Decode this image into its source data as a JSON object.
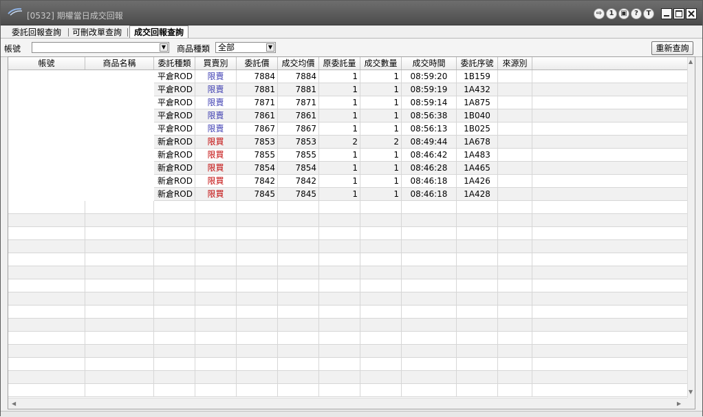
{
  "window": {
    "title": "[0532] 期權當日成交回報",
    "title_buttons": [
      "1",
      "?",
      "T"
    ]
  },
  "tabs": [
    {
      "label": "委託回報查詢",
      "active": false
    },
    {
      "label": "可刪改單查詢",
      "active": false
    },
    {
      "label": "成交回報查詢",
      "active": true
    }
  ],
  "filters": {
    "account_label": "帳號",
    "account_value": "",
    "product_type_label": "商品種類",
    "product_type_value": "全部",
    "requery_label": "重新查詢"
  },
  "colors": {
    "sell": "#3a3ab0",
    "buy": "#c00000",
    "titlebar": "#5a5a5a"
  },
  "table": {
    "headers": [
      "帳號",
      "商品名稱",
      "委託種類",
      "買賣別",
      "委託價",
      "成交均價",
      "原委託量",
      "成交數量",
      "成交時間",
      "委託序號",
      "來源別"
    ],
    "rows": [
      {
        "account": "",
        "product": "",
        "order_type": "平倉ROD",
        "side": "限賣",
        "order_price": "7884",
        "avg_price": "7884",
        "orig_qty": "1",
        "fill_qty": "1",
        "time": "08:59:20",
        "seq": "1B159",
        "source": ""
      },
      {
        "account": "",
        "product": "",
        "order_type": "平倉ROD",
        "side": "限賣",
        "order_price": "7881",
        "avg_price": "7881",
        "orig_qty": "1",
        "fill_qty": "1",
        "time": "08:59:19",
        "seq": "1A432",
        "source": ""
      },
      {
        "account": "",
        "product": "",
        "order_type": "平倉ROD",
        "side": "限賣",
        "order_price": "7871",
        "avg_price": "7871",
        "orig_qty": "1",
        "fill_qty": "1",
        "time": "08:59:14",
        "seq": "1A875",
        "source": ""
      },
      {
        "account": "",
        "product": "",
        "order_type": "平倉ROD",
        "side": "限賣",
        "order_price": "7861",
        "avg_price": "7861",
        "orig_qty": "1",
        "fill_qty": "1",
        "time": "08:56:38",
        "seq": "1B040",
        "source": ""
      },
      {
        "account": "",
        "product": "",
        "order_type": "平倉ROD",
        "side": "限賣",
        "order_price": "7867",
        "avg_price": "7867",
        "orig_qty": "1",
        "fill_qty": "1",
        "time": "08:56:13",
        "seq": "1B025",
        "source": ""
      },
      {
        "account": "",
        "product": "",
        "order_type": "新倉ROD",
        "side": "限買",
        "order_price": "7853",
        "avg_price": "7853",
        "orig_qty": "2",
        "fill_qty": "2",
        "time": "08:49:44",
        "seq": "1A678",
        "source": ""
      },
      {
        "account": "",
        "product": "",
        "order_type": "新倉ROD",
        "side": "限買",
        "order_price": "7855",
        "avg_price": "7855",
        "orig_qty": "1",
        "fill_qty": "1",
        "time": "08:46:42",
        "seq": "1A483",
        "source": ""
      },
      {
        "account": "",
        "product": "",
        "order_type": "新倉ROD",
        "side": "限買",
        "order_price": "7854",
        "avg_price": "7854",
        "orig_qty": "1",
        "fill_qty": "1",
        "time": "08:46:28",
        "seq": "1A465",
        "source": ""
      },
      {
        "account": "",
        "product": "",
        "order_type": "新倉ROD",
        "side": "限買",
        "order_price": "7842",
        "avg_price": "7842",
        "orig_qty": "1",
        "fill_qty": "1",
        "time": "08:46:18",
        "seq": "1A426",
        "source": ""
      },
      {
        "account": "",
        "product": "",
        "order_type": "新倉ROD",
        "side": "限買",
        "order_price": "7845",
        "avg_price": "7845",
        "orig_qty": "1",
        "fill_qty": "1",
        "time": "08:46:18",
        "seq": "1A428",
        "source": ""
      }
    ]
  }
}
